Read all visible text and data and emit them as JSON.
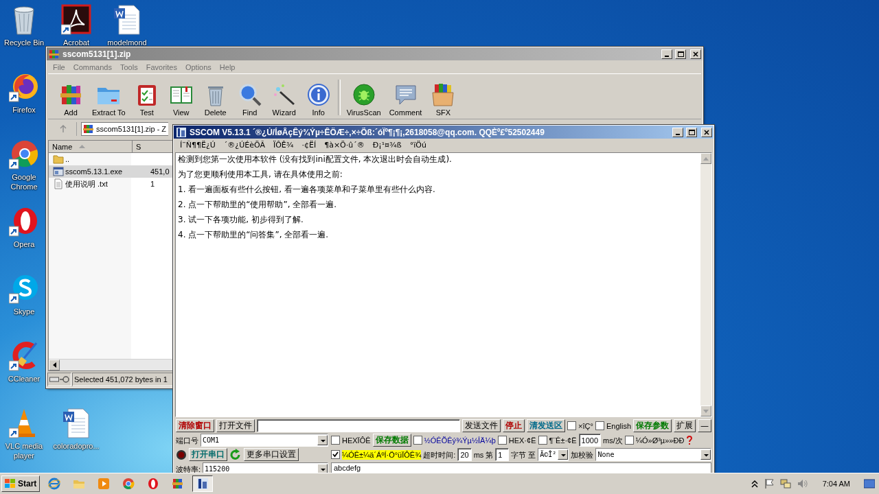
{
  "desktop": {
    "icons": [
      {
        "label": "Recycle Bin",
        "kind": "bin"
      },
      {
        "label": "Acrobat",
        "kind": "acrobat"
      },
      {
        "label": "modelmond",
        "kind": "word"
      },
      {
        "label": "Firefox",
        "kind": "firefox"
      },
      {
        "label": "Google Chrome",
        "kind": "chrome"
      },
      {
        "label": "Opera",
        "kind": "opera"
      },
      {
        "label": "Skype",
        "kind": "skype"
      },
      {
        "label": "CCleaner",
        "kind": "ccleaner"
      },
      {
        "label": "VLC media player",
        "kind": "vlc"
      },
      {
        "label": "coloradopro...",
        "kind": "word"
      }
    ]
  },
  "archive_window": {
    "title": "sscom5131[1].zip",
    "active": false,
    "menu": [
      "File",
      "Commands",
      "Tools",
      "Favorites",
      "Options",
      "Help"
    ],
    "toolbar": [
      {
        "label": "Add",
        "kind": "add",
        "separator_before": false
      },
      {
        "label": "Extract To",
        "kind": "extract",
        "separator_before": false
      },
      {
        "label": "Test",
        "kind": "test",
        "separator_before": false
      },
      {
        "label": "View",
        "kind": "view",
        "separator_before": false
      },
      {
        "label": "Delete",
        "kind": "delete",
        "separator_before": false
      },
      {
        "label": "Find",
        "kind": "find",
        "separator_before": false
      },
      {
        "label": "Wizard",
        "kind": "wizard",
        "separator_before": false
      },
      {
        "label": "Info",
        "kind": "info",
        "separator_before": false
      },
      {
        "label": "VirusScan",
        "kind": "virusscan",
        "separator_before": true
      },
      {
        "label": "Comment",
        "kind": "comment",
        "separator_before": false
      },
      {
        "label": "SFX",
        "kind": "sfx",
        "separator_before": false
      }
    ],
    "address": "sscom5131[1].zip - Z",
    "columns": [
      {
        "label": "Name",
        "sorted": true
      },
      {
        "label": "S",
        "sorted": false
      }
    ],
    "files": [
      {
        "name": "..",
        "kind": "folder",
        "selected": false
      },
      {
        "name": "sscom5.13.1.exe",
        "size": "451,0",
        "kind": "exe",
        "selected": true
      },
      {
        "name": "使用说明 .txt",
        "size": "1",
        "kind": "text",
        "selected": false
      }
    ],
    "status": "Selected 451,072 bytes in 1"
  },
  "serial_window": {
    "title": "SSCOM V5.13.1 ´®¿Ú/ÍøÂçÊý¾Ýµ÷ÊÔÆ÷,×÷Õß:´óÏº¶¡¶¡,2618058@qq.com. QQÈº£º52502449",
    "active": true,
    "menu": [
      "Í¨Ñ¶¶Ë¿Ú",
      "´®¿ÚÉèÖÃ",
      "ÏÔÊ¾",
      "·¢ËÍ",
      "¶à×Ö·û´®",
      "Ð¡¹¤¾ß",
      "°ïÖú"
    ],
    "log_lines": [
      "检测到您第一次使用本软件 (没有找到ini配置文件, 本次退出时会自动生成).",
      "为了您更顺利使用本工具, 请在具体使用之前:",
      "1. 看一遍面板有些什么按钮, 看一遍各项菜单和子菜单里有些什么内容.",
      "2. 点一下帮助里的“使用帮助”, 全部看一遍.",
      "3. 试一下各项功能, 初步得到了解.",
      "4. 点一下帮助里的“问答集”, 全部看一遍."
    ],
    "top_row": [
      {
        "kind": "button",
        "label": "清除窗口",
        "color": "#b00000"
      },
      {
        "kind": "button",
        "label": "打开文件"
      },
      {
        "kind": "field"
      },
      {
        "kind": "button",
        "label": "发送文件"
      },
      {
        "kind": "button",
        "label": "停止",
        "color": "#b00000"
      },
      {
        "kind": "button",
        "label": "清发送区",
        "color": "#006a8a"
      },
      {
        "kind": "checkbox",
        "label": "×îÇ°",
        "checked": false
      },
      {
        "kind": "checkbox",
        "label": "English",
        "checked": false
      },
      {
        "kind": "button",
        "label": "保存参数",
        "color": "#007a00"
      },
      {
        "kind": "button",
        "label": "扩展"
      },
      {
        "kind": "button",
        "label": "—"
      }
    ],
    "left_rows": [
      [
        {
          "kind": "label",
          "label": "端口号"
        },
        {
          "kind": "select",
          "value": "COM1"
        }
      ],
      [
        {
          "kind": "led"
        },
        {
          "kind": "button",
          "label": "打开串口",
          "color": "#006a6a"
        },
        {
          "kind": "refresh"
        },
        {
          "kind": "button",
          "label": "更多串口设置"
        }
      ],
      [
        {
          "kind": "label",
          "label": "波特率:"
        },
        {
          "kind": "select",
          "value": "115200"
        }
      ]
    ],
    "right_rows": [
      [
        {
          "kind": "checkbox",
          "label": "HEXÏÔÊ",
          "checked": false
        },
        {
          "kind": "button",
          "label": "保存数据",
          "color": "#007a00"
        },
        {
          "kind": "checkbox",
          "label": "½ÓÊÕÊý¾Ýµ½ÎÄ¼þ",
          "checked": false,
          "color": "#00009c"
        },
        {
          "kind": "checkbox",
          "label": "HEX·¢Ë",
          "checked": false
        },
        {
          "kind": "checkbox",
          "label": "¶¨Ê±·¢Ë",
          "checked": false
        },
        {
          "kind": "field",
          "value": "1000"
        },
        {
          "kind": "label",
          "label": "ms/次"
        },
        {
          "kind": "checkbox",
          "label": "¼Ó»Ø³µ»»ÐÐ",
          "checked": false
        },
        {
          "kind": "help"
        }
      ],
      [
        {
          "kind": "checkbox",
          "label": "¼ÓÊ±¼ä´ÁºÍ·Ö°üÏÔÊ¾",
          "checked": true,
          "highlight": true
        },
        {
          "kind": "label",
          "label": "超时时间:"
        },
        {
          "kind": "field",
          "value": "20"
        },
        {
          "kind": "label",
          "label": "ms"
        },
        {
          "kind": "label",
          "label": "第"
        },
        {
          "kind": "field",
          "value": "1"
        },
        {
          "kind": "label",
          "label": "字节"
        },
        {
          "kind": "label",
          "label": "至"
        },
        {
          "kind": "select",
          "value": "Ä©Î²"
        },
        {
          "kind": "label",
          "label": "加校验"
        },
        {
          "kind": "select",
          "value": "None"
        }
      ],
      [
        {
          "kind": "textarea",
          "value": "abcdefg"
        }
      ]
    ]
  },
  "taskbar": {
    "start": "Start",
    "apps": [
      {
        "kind": "ie",
        "active": false
      },
      {
        "kind": "explorer",
        "active": false
      },
      {
        "kind": "media",
        "active": false
      },
      {
        "kind": "chrome",
        "active": false
      },
      {
        "kind": "opera",
        "active": false
      },
      {
        "kind": "winrar",
        "active": false
      },
      {
        "kind": "sscom",
        "active": true
      }
    ],
    "clock": "7:04 AM"
  }
}
